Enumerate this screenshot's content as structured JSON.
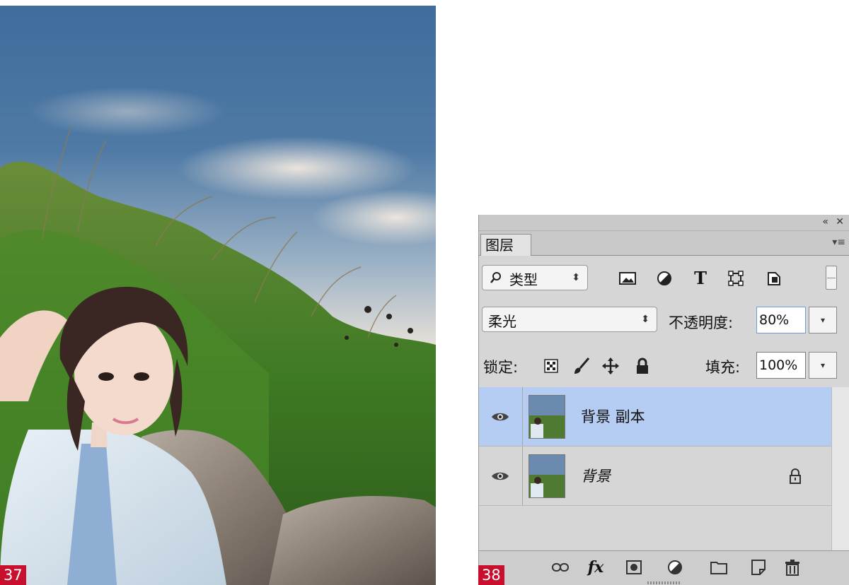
{
  "figures": {
    "left_number": "37",
    "right_number": "38"
  },
  "panel": {
    "collapse_icon": "double-chevron-left-icon",
    "close_icon": "close-icon",
    "tab_label": "图层",
    "menu_icon": "panel-menu-icon",
    "filter": {
      "search_icon": "search-icon",
      "kind_label": "类型",
      "filter_icons": [
        "pixel-layer-filter-icon",
        "adjustment-layer-filter-icon",
        "type-layer-filter-icon",
        "shape-layer-filter-icon",
        "smart-object-filter-icon"
      ]
    },
    "blend_mode": "柔光",
    "opacity_label": "不透明度:",
    "opacity_value": "80%",
    "lock_label": "锁定:",
    "fill_label": "填充:",
    "fill_value": "100%",
    "layers": [
      {
        "name": "背景 副本",
        "selected": true,
        "visible": true,
        "locked": false
      },
      {
        "name": "背景",
        "selected": false,
        "visible": true,
        "locked": true
      }
    ],
    "footer_icons": [
      "link-layers-icon",
      "fx-icon",
      "add-mask-icon",
      "adjustment-layer-icon",
      "new-group-icon",
      "new-layer-icon",
      "delete-icon"
    ],
    "fx_label": "fx",
    "colors": {
      "panel_bg": "#d6d6d6",
      "selected_row": "#b6cdf3",
      "badge_red": "#c8102e"
    }
  }
}
